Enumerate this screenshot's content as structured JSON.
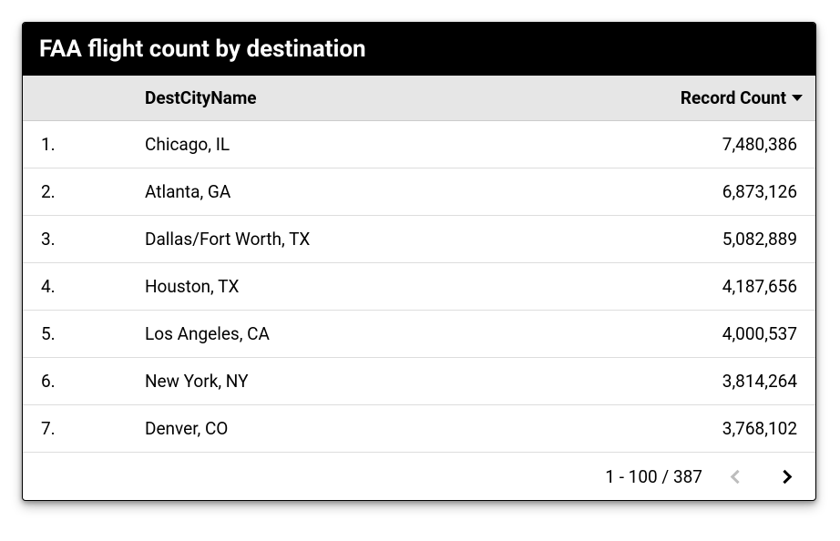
{
  "title": "FAA flight count by destination",
  "columns": {
    "rank": "",
    "name": "DestCityName",
    "count": "Record Count"
  },
  "sort": {
    "column": "count",
    "direction": "desc"
  },
  "rows": [
    {
      "rank": "1.",
      "name": "Chicago, IL",
      "count": "7,480,386"
    },
    {
      "rank": "2.",
      "name": "Atlanta, GA",
      "count": "6,873,126"
    },
    {
      "rank": "3.",
      "name": "Dallas/Fort Worth, TX",
      "count": "5,082,889"
    },
    {
      "rank": "4.",
      "name": "Houston, TX",
      "count": "4,187,656"
    },
    {
      "rank": "5.",
      "name": "Los Angeles, CA",
      "count": "4,000,537"
    },
    {
      "rank": "6.",
      "name": "New York, NY",
      "count": "3,814,264"
    },
    {
      "rank": "7.",
      "name": "Denver, CO",
      "count": "3,768,102"
    }
  ],
  "pagination": {
    "label": "1 - 100 / 387"
  },
  "chart_data": {
    "type": "table",
    "title": "FAA flight count by destination",
    "columns": [
      "DestCityName",
      "Record Count"
    ],
    "sorted_by": "Record Count",
    "sort_direction": "desc",
    "rows": [
      [
        "Chicago, IL",
        7480386
      ],
      [
        "Atlanta, GA",
        6873126
      ],
      [
        "Dallas/Fort Worth, TX",
        5082889
      ],
      [
        "Houston, TX",
        4187656
      ],
      [
        "Los Angeles, CA",
        4000537
      ],
      [
        "New York, NY",
        3814264
      ],
      [
        "Denver, CO",
        3768102
      ]
    ],
    "page_range": "1 - 100",
    "total_rows": 387
  }
}
